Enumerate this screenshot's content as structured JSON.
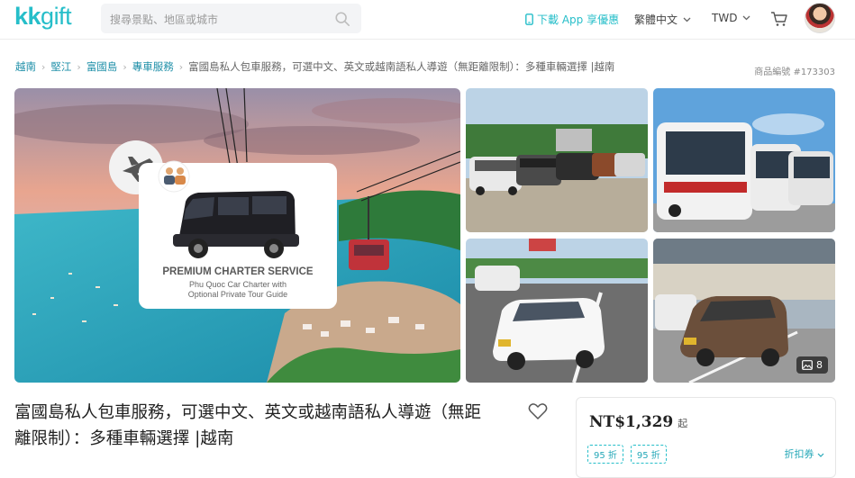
{
  "header": {
    "logo_kk": "kk",
    "logo_gift": "gift",
    "search_placeholder": "搜尋景點、地區或城市",
    "download_app": "下載 App 享優惠",
    "language": "繁體中文",
    "currency": "TWD",
    "brand_color": "#26bec9"
  },
  "breadcrumb": {
    "items": [
      "越南",
      "堅江",
      "富國島",
      "專車服務"
    ],
    "current": "富國島私人包車服務，可選中文、英文或越南語私人導遊（無距離限制）：多種車輛選擇 |越南",
    "product_no": "商品編號 #173303"
  },
  "gallery": {
    "main_card_title": "PREMIUM CHARTER SERVICE",
    "main_card_sub1": "Phu Quoc Car Charter with",
    "main_card_sub2": "Optional Private Tour Guide",
    "photo_count": "8"
  },
  "product": {
    "title_line1": "富國島私人包車服務，可選中文、英文或越南語私人導遊（無距",
    "title_line2": "離限制）：多種車輛選擇 |越南"
  },
  "pricing": {
    "price": "NT$1,329",
    "price_suffix": "起",
    "discount_tags": [
      "95 折",
      "95 折"
    ],
    "coupon_label": "折扣券"
  }
}
